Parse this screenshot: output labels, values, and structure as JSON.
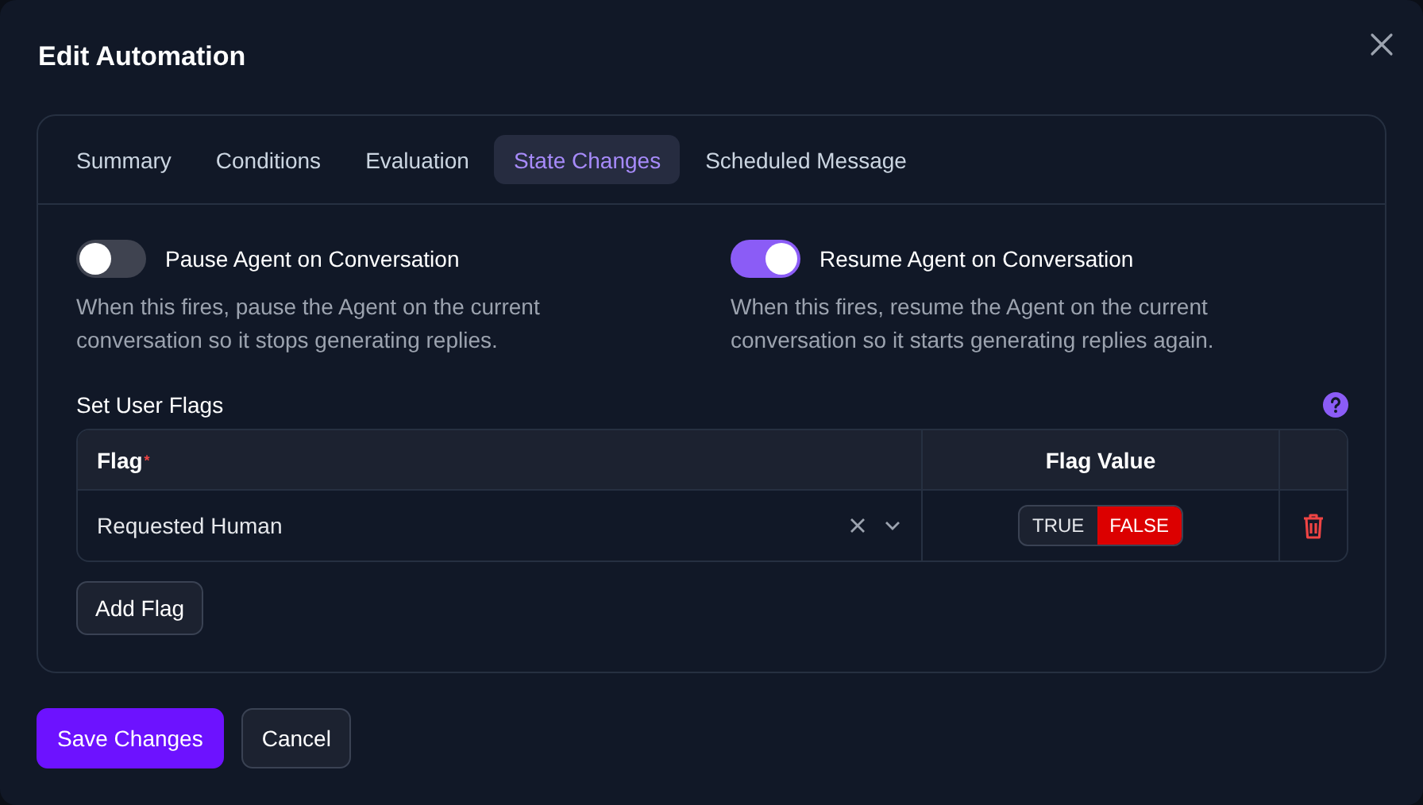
{
  "dialog": {
    "title": "Edit Automation"
  },
  "tabs": [
    {
      "label": "Summary",
      "selected": false
    },
    {
      "label": "Conditions",
      "selected": false
    },
    {
      "label": "Evaluation",
      "selected": false
    },
    {
      "label": "State Changes",
      "selected": true
    },
    {
      "label": "Scheduled Message",
      "selected": false
    }
  ],
  "toggles": [
    {
      "label": "Pause Agent on Conversation",
      "description": "When this fires, pause the Agent on the current conversation so it stops generating replies.",
      "on": false
    },
    {
      "label": "Resume Agent on Conversation",
      "description": "When this fires, resume the Agent on the current conversation so it starts generating replies again.",
      "on": true
    }
  ],
  "user_flags": {
    "title": "Set User Flags",
    "columns": [
      {
        "label": "Flag",
        "required_mark": "*"
      },
      {
        "label": "Flag Value"
      }
    ],
    "rows": [
      {
        "flag": "Requested Human",
        "options": [
          {
            "label": "TRUE",
            "selected": false
          },
          {
            "label": "FALSE",
            "selected": true
          }
        ]
      }
    ],
    "add_button": "Add Flag"
  },
  "buttons": [
    {
      "label": "Save Changes",
      "kind": "primary"
    },
    {
      "label": "Cancel",
      "kind": "secondary"
    }
  ]
}
